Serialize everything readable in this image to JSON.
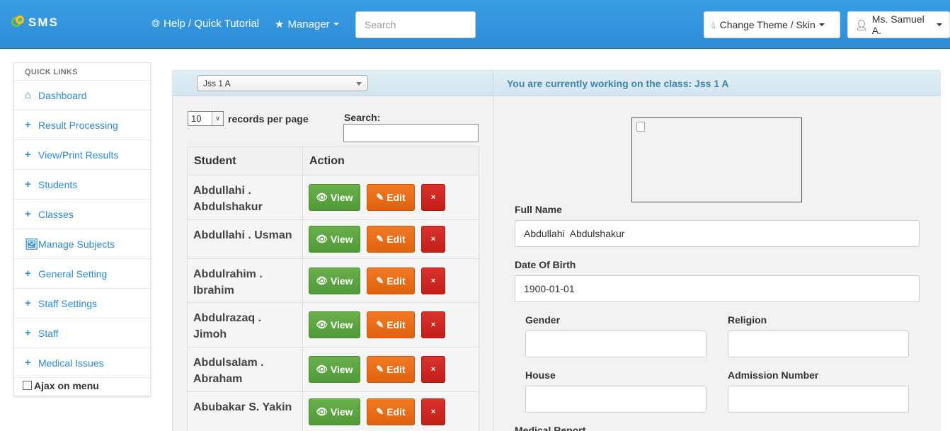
{
  "topbar": {
    "brand": "SMS",
    "help_link": "Help / Quick Tutorial",
    "manager_menu": "Manager",
    "search_placeholder": "Search",
    "theme_button": "Change Theme / Skin",
    "user_menu": "Ms. Samuel A."
  },
  "sidebar": {
    "heading": "QUICK LINKS",
    "items": [
      {
        "label": "Dashboard",
        "icon": "home-icon"
      },
      {
        "label": "Result Processing",
        "icon": "plus-icon"
      },
      {
        "label": "View/Print Results",
        "icon": "plus-icon"
      },
      {
        "label": "Students",
        "icon": "plus-icon"
      },
      {
        "label": "Classes",
        "icon": "plus-icon"
      },
      {
        "label": "Manage Subjects",
        "icon": "picture-icon"
      },
      {
        "label": "General Setting",
        "icon": "plus-icon"
      },
      {
        "label": "Staff Settings",
        "icon": "plus-icon"
      },
      {
        "label": "Staff",
        "icon": "plus-icon"
      },
      {
        "label": "Medical Issues",
        "icon": "plus-icon"
      }
    ],
    "ajax_label": "Ajax on menu"
  },
  "main": {
    "class_select": "Jss 1 A",
    "working_text": "You are currently working on the class: Jss 1 A"
  },
  "list": {
    "per_page_value": "10",
    "per_page_label": "records per page",
    "search_label": "Search:",
    "columns": [
      "Student",
      "Action"
    ],
    "view_label": "View",
    "edit_label": "Edit",
    "delete_label": "×",
    "rows": [
      {
        "name": "Abdullahi . Abdulshakur"
      },
      {
        "name": "Abdullahi . Usman"
      },
      {
        "name": "Abdulrahim . Ibrahim"
      },
      {
        "name": "Abdulrazaq . Jimoh"
      },
      {
        "name": "Abdulsalam . Abraham"
      },
      {
        "name": "Abubakar S. Yakin"
      }
    ]
  },
  "form": {
    "full_name_label": "Full Name",
    "full_name_value": "Abdullahi  Abdulshakur",
    "dob_label": "Date Of Birth",
    "dob_value": "1900-01-01",
    "gender_label": "Gender",
    "gender_value": "",
    "religion_label": "Religion",
    "religion_value": "",
    "house_label": "House",
    "house_value": "",
    "admission_label": "Admission Number",
    "admission_value": "",
    "medical_label": "Medical Report"
  },
  "colors": {
    "topbar": "#2d8bd6",
    "link": "#2a8bd0",
    "view_button": "#5ca542",
    "edit_button": "#e86a17",
    "delete_button": "#cc2720",
    "working_text": "#3a87ad"
  }
}
